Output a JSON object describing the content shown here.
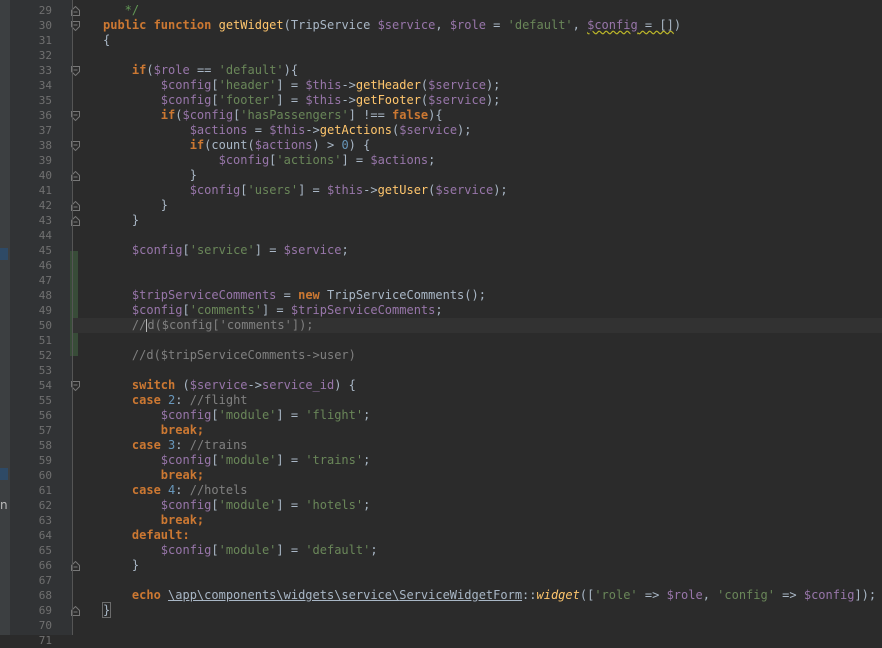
{
  "side_panel": {
    "fragment": "n"
  },
  "lines": [
    {
      "n": "29",
      "fold": "end",
      "tokens": [
        [
          "   */",
          "cm-doc"
        ]
      ]
    },
    {
      "n": "30",
      "fold": "start",
      "tokens": [
        [
          "public ",
          "kw"
        ],
        [
          "function ",
          "kw"
        ],
        [
          "getWidget",
          "fn"
        ],
        [
          "(TripService ",
          "plain"
        ],
        [
          "$service",
          "var"
        ],
        [
          ", ",
          "plain"
        ],
        [
          "$role",
          "var"
        ],
        [
          " = ",
          "plain"
        ],
        [
          "'default'",
          "str"
        ],
        [
          ", ",
          "plain"
        ],
        [
          "$config",
          "var ul-warn"
        ],
        [
          " = []",
          "plain ul-warn"
        ],
        [
          ")",
          "plain"
        ]
      ]
    },
    {
      "n": "31",
      "fold": "",
      "tokens": [
        [
          "{",
          "plain"
        ]
      ]
    },
    {
      "n": "32",
      "fold": "",
      "tokens": []
    },
    {
      "n": "33",
      "fold": "start",
      "tokens": [
        [
          "    ",
          "plain"
        ],
        [
          "if",
          "kw"
        ],
        [
          "(",
          "plain"
        ],
        [
          "$role",
          "var"
        ],
        [
          " == ",
          "plain"
        ],
        [
          "'default'",
          "str"
        ],
        [
          "){",
          "plain"
        ]
      ]
    },
    {
      "n": "34",
      "fold": "",
      "tokens": [
        [
          "        ",
          "plain"
        ],
        [
          "$config",
          "var"
        ],
        [
          "[",
          "plain"
        ],
        [
          "'header'",
          "str"
        ],
        [
          "] = ",
          "plain"
        ],
        [
          "$this",
          "var"
        ],
        [
          "->",
          "plain"
        ],
        [
          "getHeader",
          "fn"
        ],
        [
          "(",
          "plain"
        ],
        [
          "$service",
          "var"
        ],
        [
          ");",
          "plain"
        ]
      ]
    },
    {
      "n": "35",
      "fold": "",
      "tokens": [
        [
          "        ",
          "plain"
        ],
        [
          "$config",
          "var"
        ],
        [
          "[",
          "plain"
        ],
        [
          "'footer'",
          "str"
        ],
        [
          "] = ",
          "plain"
        ],
        [
          "$this",
          "var"
        ],
        [
          "->",
          "plain"
        ],
        [
          "getFooter",
          "fn"
        ],
        [
          "(",
          "plain"
        ],
        [
          "$service",
          "var"
        ],
        [
          ");",
          "plain"
        ]
      ]
    },
    {
      "n": "36",
      "fold": "start",
      "tokens": [
        [
          "        ",
          "plain"
        ],
        [
          "if",
          "kw"
        ],
        [
          "(",
          "plain"
        ],
        [
          "$config",
          "var"
        ],
        [
          "[",
          "plain"
        ],
        [
          "'hasPassengers'",
          "str"
        ],
        [
          "] !== ",
          "plain"
        ],
        [
          "false",
          "kw"
        ],
        [
          "){",
          "plain"
        ]
      ]
    },
    {
      "n": "37",
      "fold": "",
      "tokens": [
        [
          "            ",
          "plain"
        ],
        [
          "$actions",
          "var"
        ],
        [
          " = ",
          "plain"
        ],
        [
          "$this",
          "var"
        ],
        [
          "->",
          "plain"
        ],
        [
          "getActions",
          "fn"
        ],
        [
          "(",
          "plain"
        ],
        [
          "$service",
          "var"
        ],
        [
          ");",
          "plain"
        ]
      ]
    },
    {
      "n": "38",
      "fold": "start",
      "tokens": [
        [
          "            ",
          "plain"
        ],
        [
          "if",
          "kw"
        ],
        [
          "(count(",
          "plain"
        ],
        [
          "$actions",
          "var"
        ],
        [
          ") > ",
          "plain"
        ],
        [
          "0",
          "num"
        ],
        [
          ") {",
          "plain"
        ]
      ]
    },
    {
      "n": "39",
      "fold": "",
      "tokens": [
        [
          "                ",
          "plain"
        ],
        [
          "$config",
          "var"
        ],
        [
          "[",
          "plain"
        ],
        [
          "'actions'",
          "str"
        ],
        [
          "] = ",
          "plain"
        ],
        [
          "$actions",
          "var"
        ],
        [
          ";",
          "plain"
        ]
      ]
    },
    {
      "n": "40",
      "fold": "end",
      "tokens": [
        [
          "            }",
          "plain"
        ]
      ]
    },
    {
      "n": "41",
      "fold": "",
      "tokens": [
        [
          "            ",
          "plain"
        ],
        [
          "$config",
          "var"
        ],
        [
          "[",
          "plain"
        ],
        [
          "'users'",
          "str"
        ],
        [
          "] = ",
          "plain"
        ],
        [
          "$this",
          "var"
        ],
        [
          "->",
          "plain"
        ],
        [
          "getUser",
          "fn"
        ],
        [
          "(",
          "plain"
        ],
        [
          "$service",
          "var"
        ],
        [
          ");",
          "plain"
        ]
      ]
    },
    {
      "n": "42",
      "fold": "end",
      "tokens": [
        [
          "        }",
          "plain"
        ]
      ]
    },
    {
      "n": "43",
      "fold": "end",
      "tokens": [
        [
          "    }",
          "plain"
        ]
      ]
    },
    {
      "n": "44",
      "fold": "",
      "tokens": []
    },
    {
      "n": "45",
      "fold": "",
      "tokens": [
        [
          "    ",
          "plain"
        ],
        [
          "$config",
          "var"
        ],
        [
          "[",
          "plain"
        ],
        [
          "'service'",
          "str"
        ],
        [
          "] = ",
          "plain"
        ],
        [
          "$service",
          "var"
        ],
        [
          ";",
          "plain"
        ]
      ]
    },
    {
      "n": "46",
      "fold": "",
      "tokens": []
    },
    {
      "n": "47",
      "fold": "",
      "tokens": []
    },
    {
      "n": "48",
      "fold": "",
      "tokens": [
        [
          "    ",
          "plain"
        ],
        [
          "$tripServiceComments",
          "var"
        ],
        [
          " = ",
          "plain"
        ],
        [
          "new ",
          "kw"
        ],
        [
          "TripServiceComments();",
          "plain"
        ]
      ]
    },
    {
      "n": "49",
      "fold": "",
      "tokens": [
        [
          "    ",
          "plain"
        ],
        [
          "$config",
          "var"
        ],
        [
          "[",
          "plain"
        ],
        [
          "'comments'",
          "str"
        ],
        [
          "] = ",
          "plain"
        ],
        [
          "$tripServiceComments",
          "var"
        ],
        [
          ";",
          "plain"
        ]
      ]
    },
    {
      "n": "50",
      "fold": "",
      "current": true,
      "tokens": [
        [
          "    //",
          "cm"
        ],
        [
          "|",
          "caret"
        ],
        [
          "d($config['comments']);",
          "cm"
        ]
      ]
    },
    {
      "n": "51",
      "fold": "",
      "tokens": []
    },
    {
      "n": "52",
      "fold": "",
      "tokens": [
        [
          "    //d($tripServiceComments->user)",
          "cm"
        ]
      ]
    },
    {
      "n": "53",
      "fold": "",
      "tokens": []
    },
    {
      "n": "54",
      "fold": "start",
      "tokens": [
        [
          "    ",
          "plain"
        ],
        [
          "switch ",
          "kw"
        ],
        [
          "(",
          "plain"
        ],
        [
          "$service",
          "var"
        ],
        [
          "->",
          "plain"
        ],
        [
          "service_id",
          "var"
        ],
        [
          ") {",
          "plain"
        ]
      ]
    },
    {
      "n": "55",
      "fold": "",
      "tokens": [
        [
          "    ",
          "plain"
        ],
        [
          "case ",
          "kw"
        ],
        [
          "2",
          "num"
        ],
        [
          ": ",
          "plain"
        ],
        [
          "//flight",
          "cm"
        ]
      ]
    },
    {
      "n": "56",
      "fold": "",
      "tokens": [
        [
          "        ",
          "plain"
        ],
        [
          "$config",
          "var"
        ],
        [
          "[",
          "plain"
        ],
        [
          "'module'",
          "str"
        ],
        [
          "] = ",
          "plain"
        ],
        [
          "'flight'",
          "str"
        ],
        [
          ";",
          "plain"
        ]
      ]
    },
    {
      "n": "57",
      "fold": "",
      "tokens": [
        [
          "        ",
          "plain"
        ],
        [
          "break",
          "kw"
        ],
        [
          ";",
          "kw"
        ]
      ]
    },
    {
      "n": "58",
      "fold": "",
      "tokens": [
        [
          "    ",
          "plain"
        ],
        [
          "case ",
          "kw"
        ],
        [
          "3",
          "num"
        ],
        [
          ": ",
          "plain"
        ],
        [
          "//trains",
          "cm"
        ]
      ]
    },
    {
      "n": "59",
      "fold": "",
      "tokens": [
        [
          "        ",
          "plain"
        ],
        [
          "$config",
          "var"
        ],
        [
          "[",
          "plain"
        ],
        [
          "'module'",
          "str"
        ],
        [
          "] = ",
          "plain"
        ],
        [
          "'trains'",
          "str"
        ],
        [
          ";",
          "plain"
        ]
      ]
    },
    {
      "n": "60",
      "fold": "",
      "tokens": [
        [
          "        ",
          "plain"
        ],
        [
          "break",
          "kw"
        ],
        [
          ";",
          "kw"
        ]
      ]
    },
    {
      "n": "61",
      "fold": "",
      "tokens": [
        [
          "    ",
          "plain"
        ],
        [
          "case ",
          "kw"
        ],
        [
          "4",
          "num"
        ],
        [
          ": ",
          "plain"
        ],
        [
          "//hotels",
          "cm"
        ]
      ]
    },
    {
      "n": "62",
      "fold": "",
      "tokens": [
        [
          "        ",
          "plain"
        ],
        [
          "$config",
          "var"
        ],
        [
          "[",
          "plain"
        ],
        [
          "'module'",
          "str"
        ],
        [
          "] = ",
          "plain"
        ],
        [
          "'hotels'",
          "str"
        ],
        [
          ";",
          "plain"
        ]
      ]
    },
    {
      "n": "63",
      "fold": "",
      "tokens": [
        [
          "        ",
          "plain"
        ],
        [
          "break",
          "kw"
        ],
        [
          ";",
          "kw"
        ]
      ]
    },
    {
      "n": "64",
      "fold": "",
      "tokens": [
        [
          "    ",
          "plain"
        ],
        [
          "default",
          "kw"
        ],
        [
          ":",
          "kw"
        ]
      ]
    },
    {
      "n": "65",
      "fold": "",
      "tokens": [
        [
          "        ",
          "plain"
        ],
        [
          "$config",
          "var"
        ],
        [
          "[",
          "plain"
        ],
        [
          "'module'",
          "str"
        ],
        [
          "] = ",
          "plain"
        ],
        [
          "'default'",
          "str"
        ],
        [
          ";",
          "plain"
        ]
      ]
    },
    {
      "n": "66",
      "fold": "end",
      "tokens": [
        [
          "    }",
          "plain"
        ]
      ]
    },
    {
      "n": "67",
      "fold": "",
      "tokens": []
    },
    {
      "n": "68",
      "fold": "",
      "tokens": [
        [
          "    ",
          "plain"
        ],
        [
          "echo ",
          "kw"
        ],
        [
          "\\app\\components\\widgets\\service\\",
          "plain ul"
        ],
        [
          "ServiceWidgetForm",
          "plain ul"
        ],
        [
          "::",
          "plain"
        ],
        [
          "widget",
          "fn italic"
        ],
        [
          "([",
          "plain"
        ],
        [
          "'role'",
          "str"
        ],
        [
          " => ",
          "plain"
        ],
        [
          "$role",
          "var"
        ],
        [
          ", ",
          "plain"
        ],
        [
          "'config'",
          "str"
        ],
        [
          " => ",
          "plain"
        ],
        [
          "$config",
          "var"
        ],
        [
          "]);",
          "plain"
        ]
      ]
    },
    {
      "n": "69",
      "fold": "end",
      "tokens": [
        [
          "}",
          "plain brace-hl"
        ]
      ]
    },
    {
      "n": "70",
      "fold": "",
      "tokens": []
    },
    {
      "n": "71",
      "fold": "",
      "tokens": []
    }
  ]
}
